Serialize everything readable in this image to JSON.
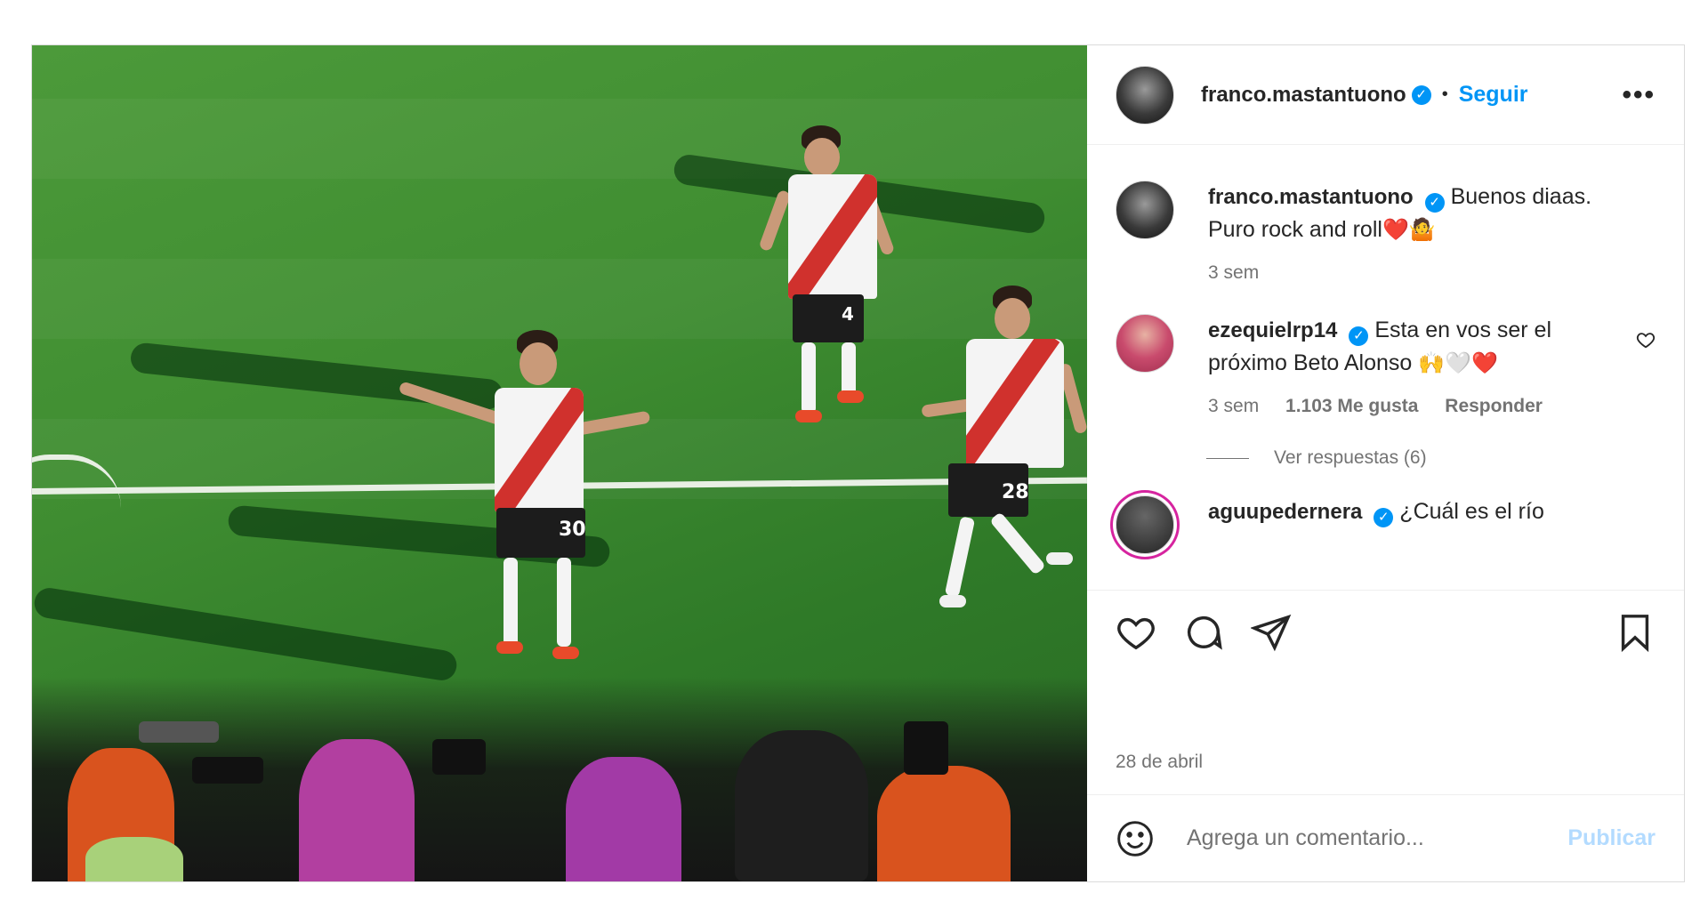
{
  "author": {
    "username": "franco.mastantuono",
    "follow_label": "Seguir",
    "separator": "•",
    "more_label": "•••"
  },
  "caption": {
    "username": "franco.mastantuono",
    "text_line1": "Buenos diaas.",
    "text_line2": "Puro rock and roll",
    "emojis": "❤️🤷",
    "time": "3 sem"
  },
  "comments": [
    {
      "username": "ezequielrp14",
      "text_line1": "Esta en vos ser el",
      "text_line2": "próximo Beto Alonso",
      "emojis": "🙌🤍❤️",
      "time": "3 sem",
      "likes": "1.103 Me gusta",
      "reply_label": "Responder",
      "view_replies": "Ver respuestas (6)"
    },
    {
      "username": "aguupedernera",
      "text": "¿Cuál es el río"
    }
  ],
  "post_date": "28 de abril",
  "add_comment": {
    "placeholder": "Agrega un comentario...",
    "publish_label": "Publicar"
  },
  "media": {
    "jersey_numbers": [
      "30",
      "4",
      "28"
    ]
  },
  "colors": {
    "accent": "#0095f6",
    "publish_disabled": "#b3dbff",
    "secondary_text": "#737373"
  }
}
